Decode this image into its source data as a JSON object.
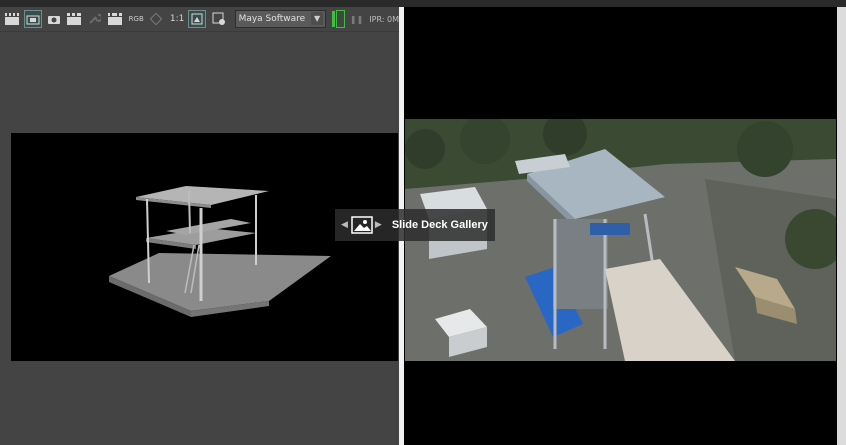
{
  "toolbar": {
    "channel_label": "RGB",
    "ratio_label": "1:1",
    "renderer": "Maya Software",
    "ipr_label": "IPR: 0M"
  },
  "overlay": {
    "title": "Slide Deck Gallery",
    "prev_icon": "chevron-left-icon",
    "next_icon": "chevron-right-icon",
    "image_icon": "image-icon"
  },
  "icons": {
    "render_frame": "clapper-icon",
    "render_region": "clapper-region-icon",
    "snapshot": "camera-icon",
    "keep_image": "clapper-keep-icon",
    "remove_image": "wrench-icon",
    "render_settings": "clapper-settings-icon",
    "display_alpha": "display-icon",
    "sync": "settings-icon",
    "ipr_render": "ipr-icon"
  },
  "colors": {
    "maya_panel": "#444444",
    "ipr_green": "#3fbf3f",
    "divider": "#f2f2f2"
  }
}
